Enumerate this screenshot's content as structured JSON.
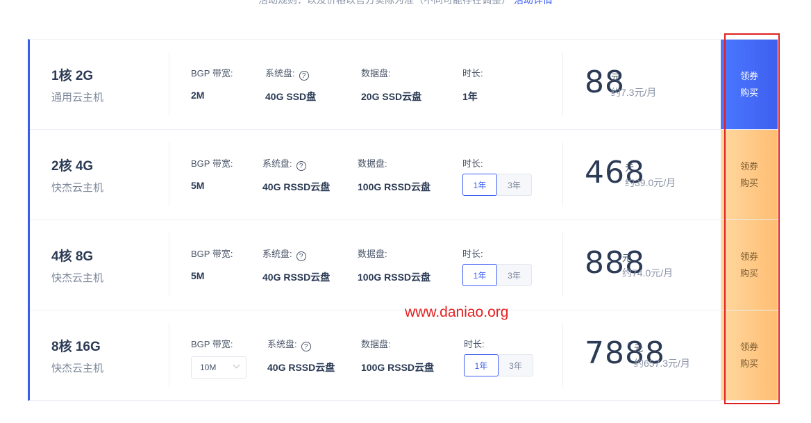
{
  "top_text": {
    "main": "活动规则：以及价格以官方实际为准（不同可能存在调整）",
    "link": "活动详情"
  },
  "labels": {
    "bandwidth": "BGP 带宽:",
    "system_disk": "系统盘:",
    "data_disk": "数据盘:",
    "duration": "时长:",
    "currency": "元",
    "buy_line1": "领券",
    "buy_line2": "购买",
    "help": "?"
  },
  "plans": [
    {
      "name": "1核 2G",
      "type": "通用云主机",
      "bandwidth": "2M",
      "system_disk": "40G SSD盘",
      "data_disk": "20G SSD云盘",
      "duration_text": "1年",
      "price": "88",
      "per_month": "约7.3元/月"
    },
    {
      "name": "2核 4G",
      "type": "快杰云主机",
      "bandwidth": "5M",
      "system_disk": "40G RSSD云盘",
      "data_disk": "100G RSSD云盘",
      "duration_options": [
        "1年",
        "3年"
      ],
      "selected_duration": "1年",
      "price": "468",
      "per_month": "约39.0元/月"
    },
    {
      "name": "4核 8G",
      "type": "快杰云主机",
      "bandwidth": "5M",
      "system_disk": "40G RSSD云盘",
      "data_disk": "100G RSSD云盘",
      "duration_options": [
        "1年",
        "3年"
      ],
      "selected_duration": "1年",
      "price": "888",
      "per_month": "约74.0元/月"
    },
    {
      "name": "8核 16G",
      "type": "快杰云主机",
      "bandwidth_select": "10M",
      "system_disk": "40G RSSD云盘",
      "data_disk": "100G RSSD云盘",
      "duration_options": [
        "1年",
        "3年"
      ],
      "selected_duration": "1年",
      "price": "7888",
      "per_month": "约657.3元/月"
    }
  ],
  "watermark": "www.daniao.org",
  "colors": {
    "accent": "#3b5cf0",
    "buy_orange": "#ffbd72",
    "highlight": "#e02020"
  }
}
